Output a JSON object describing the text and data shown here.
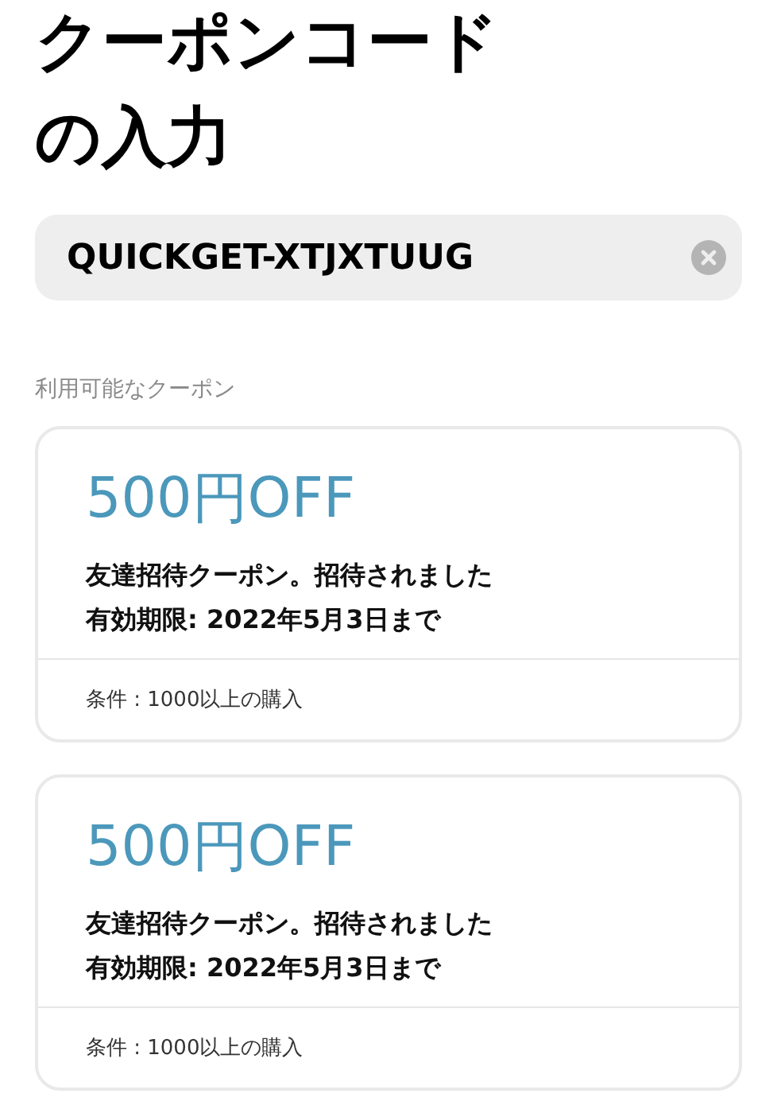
{
  "title": "クーポンコードの入力",
  "code_field": {
    "value": "QUICKGET-XTJXTUUG"
  },
  "section_label": "利用可能なクーポン",
  "coupons": [
    {
      "amount": "500円OFF",
      "description": "友達招待クーポン。招待されました",
      "expiry": "有効期限: 2022年5月3日まで",
      "condition": "条件 : 1000以上の購入"
    },
    {
      "amount": "500円OFF",
      "description": "友達招待クーポン。招待されました",
      "expiry": "有効期限: 2022年5月3日まで",
      "condition": "条件 : 1000以上の購入"
    }
  ]
}
